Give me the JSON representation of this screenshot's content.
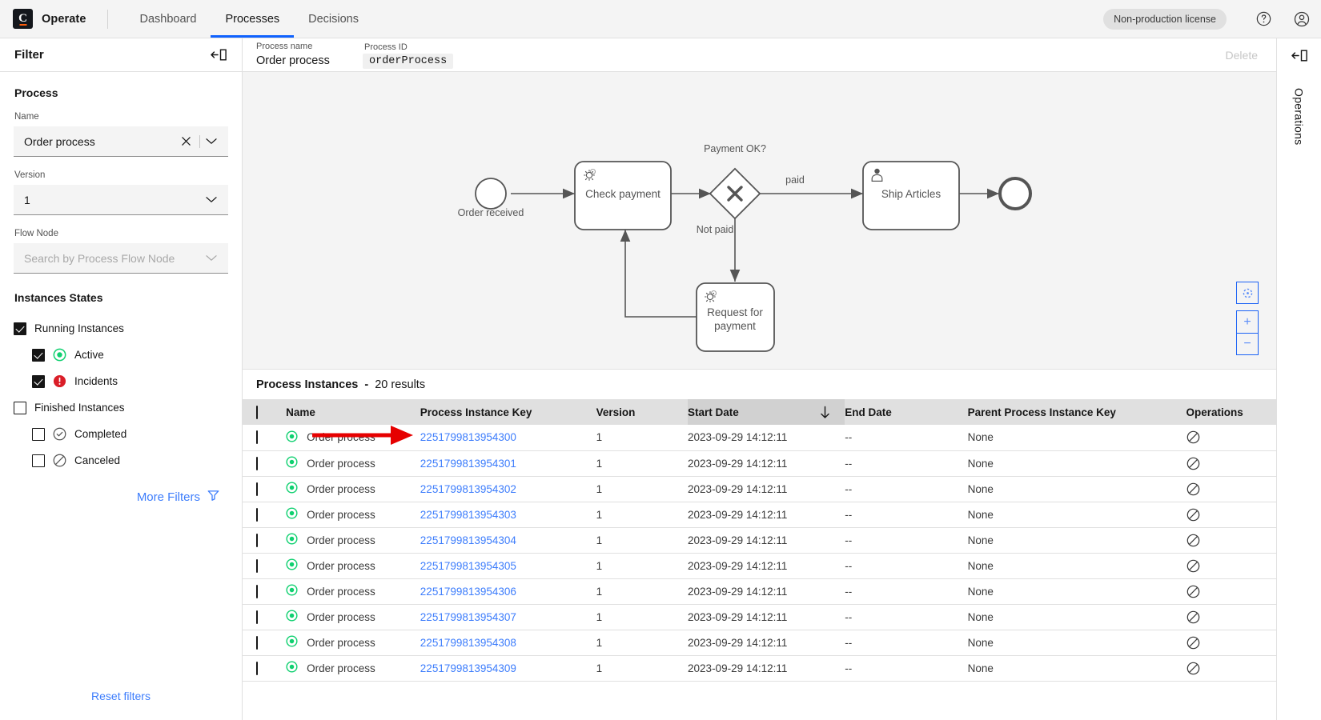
{
  "header": {
    "brand": "Operate",
    "brand_letter": "C",
    "nav": [
      {
        "label": "Dashboard",
        "active": false
      },
      {
        "label": "Processes",
        "active": true
      },
      {
        "label": "Decisions",
        "active": false
      }
    ],
    "license_badge": "Non-production license",
    "help_icon": "help-circle-icon",
    "user_icon": "user-avatar-icon"
  },
  "filter_panel": {
    "title": "Filter",
    "collapse_icon": "panel-collapse-icon",
    "process_section_title": "Process",
    "name_label": "Name",
    "name_value": "Order process",
    "version_label": "Version",
    "version_value": "1",
    "flow_node_label": "Flow Node",
    "flow_node_placeholder": "Search by Process Flow Node",
    "states_title": "Instances States",
    "states": [
      {
        "label": "Running Instances",
        "checked": true,
        "indent": false,
        "icon": "none"
      },
      {
        "label": "Active",
        "checked": true,
        "indent": true,
        "icon": "active-state-icon"
      },
      {
        "label": "Incidents",
        "checked": true,
        "indent": true,
        "icon": "incident-state-icon"
      },
      {
        "label": "Finished Instances",
        "checked": false,
        "indent": false,
        "icon": "none"
      },
      {
        "label": "Completed",
        "checked": false,
        "indent": true,
        "icon": "completed-state-icon"
      },
      {
        "label": "Canceled",
        "checked": false,
        "indent": true,
        "icon": "canceled-state-icon"
      }
    ],
    "more_filters": "More Filters",
    "reset_filters": "Reset filters"
  },
  "process_header": {
    "name_label": "Process name",
    "name_value": "Order process",
    "id_label": "Process ID",
    "id_value": "orderProcess",
    "delete_label": "Delete"
  },
  "diagram": {
    "nodes": [
      {
        "id": "start",
        "type": "start-event",
        "label": "Order received"
      },
      {
        "id": "check",
        "type": "service-task",
        "label": "Check payment"
      },
      {
        "id": "gateway",
        "type": "exclusive-gateway",
        "label": "Payment OK?"
      },
      {
        "id": "ship",
        "type": "user-task",
        "label": "Ship Articles"
      },
      {
        "id": "request",
        "type": "service-task",
        "label": "Request for\npayment"
      },
      {
        "id": "end",
        "type": "end-event",
        "label": ""
      }
    ],
    "flow_labels": [
      "paid",
      "Not paid"
    ],
    "controls": {
      "reset_label": "reset-zoom-icon",
      "zoom_in_label": "+",
      "zoom_out_label": "−"
    }
  },
  "operations_panel": {
    "title": "Operations",
    "collapse_icon": "panel-collapse-icon"
  },
  "instances": {
    "title": "Process Instances",
    "separator": "-",
    "results_text": "20 results",
    "columns": [
      "Name",
      "Process Instance Key",
      "Version",
      "Start Date",
      "End Date",
      "Parent Process Instance Key",
      "Operations"
    ],
    "sorted_column": "Start Date",
    "sort_direction": "descending",
    "rows": [
      {
        "state": "active",
        "name": "Order process",
        "key": "2251799813954300",
        "version": "1",
        "start": "2023-09-29 14:12:11",
        "end": "--",
        "parent": "None",
        "op": "cancel-operation-icon"
      },
      {
        "state": "active",
        "name": "Order process",
        "key": "2251799813954301",
        "version": "1",
        "start": "2023-09-29 14:12:11",
        "end": "--",
        "parent": "None",
        "op": "cancel-operation-icon"
      },
      {
        "state": "active",
        "name": "Order process",
        "key": "2251799813954302",
        "version": "1",
        "start": "2023-09-29 14:12:11",
        "end": "--",
        "parent": "None",
        "op": "cancel-operation-icon"
      },
      {
        "state": "active",
        "name": "Order process",
        "key": "2251799813954303",
        "version": "1",
        "start": "2023-09-29 14:12:11",
        "end": "--",
        "parent": "None",
        "op": "cancel-operation-icon"
      },
      {
        "state": "active",
        "name": "Order process",
        "key": "2251799813954304",
        "version": "1",
        "start": "2023-09-29 14:12:11",
        "end": "--",
        "parent": "None",
        "op": "cancel-operation-icon"
      },
      {
        "state": "active",
        "name": "Order process",
        "key": "2251799813954305",
        "version": "1",
        "start": "2023-09-29 14:12:11",
        "end": "--",
        "parent": "None",
        "op": "cancel-operation-icon"
      },
      {
        "state": "active",
        "name": "Order process",
        "key": "2251799813954306",
        "version": "1",
        "start": "2023-09-29 14:12:11",
        "end": "--",
        "parent": "None",
        "op": "cancel-operation-icon"
      },
      {
        "state": "active",
        "name": "Order process",
        "key": "2251799813954307",
        "version": "1",
        "start": "2023-09-29 14:12:11",
        "end": "--",
        "parent": "None",
        "op": "cancel-operation-icon"
      },
      {
        "state": "active",
        "name": "Order process",
        "key": "2251799813954308",
        "version": "1",
        "start": "2023-09-29 14:12:11",
        "end": "--",
        "parent": "None",
        "op": "cancel-operation-icon"
      },
      {
        "state": "active",
        "name": "Order process",
        "key": "2251799813954309",
        "version": "1",
        "start": "2023-09-29 14:12:11",
        "end": "--",
        "parent": "None",
        "op": "cancel-operation-icon"
      }
    ]
  },
  "annotation": {
    "type": "red-arrow",
    "points_to": "first-row-process-instance-key"
  },
  "colors": {
    "accent_blue": "#0f62fe",
    "link_blue": "#3d7dfc",
    "active_green": "#10d070",
    "incident_red": "#da1e28",
    "annotation_red": "#e60000",
    "header_bg": "#f4f4f4",
    "table_header_bg": "#e0e0e0"
  }
}
